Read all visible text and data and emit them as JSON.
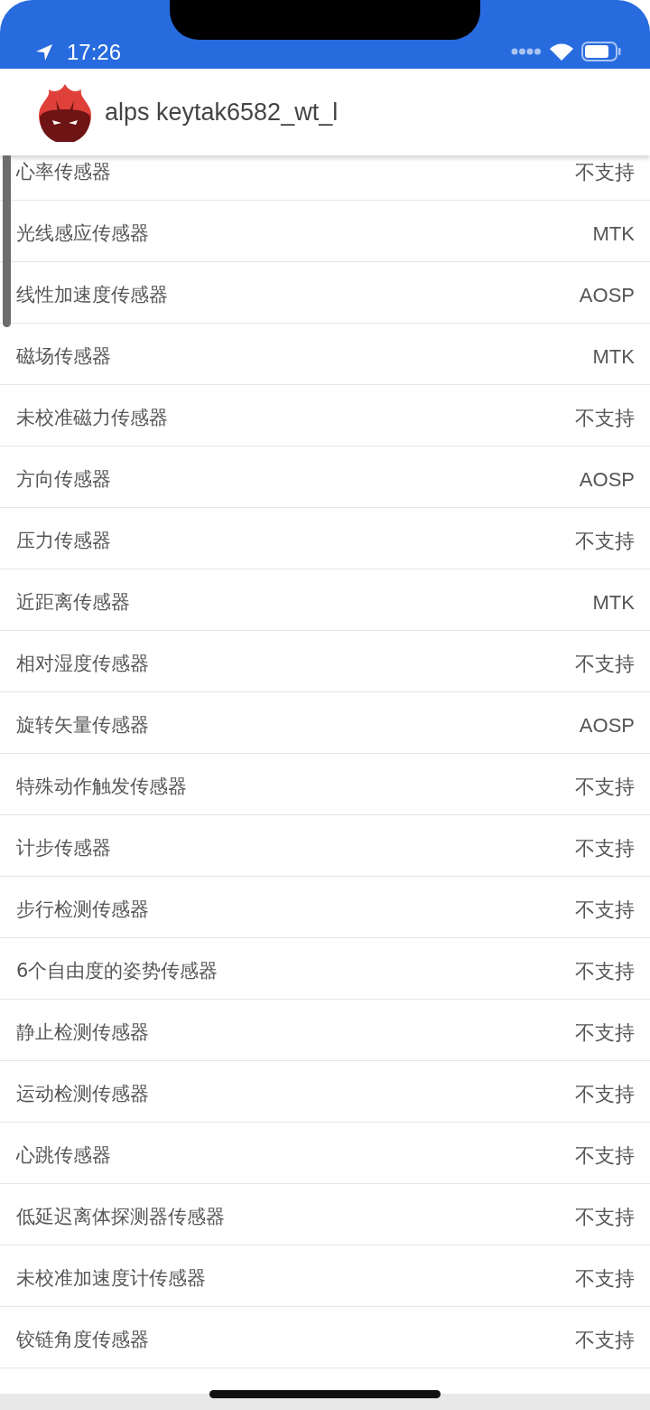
{
  "status_bar": {
    "time": "17:26"
  },
  "header": {
    "title": "alps keytak6582_wt_l"
  },
  "sensors": [
    {
      "name": "心率传感器",
      "value": "不支持"
    },
    {
      "name": "光线感应传感器",
      "value": "MTK"
    },
    {
      "name": "线性加速度传感器",
      "value": "AOSP"
    },
    {
      "name": "磁场传感器",
      "value": "MTK"
    },
    {
      "name": "未校准磁力传感器",
      "value": "不支持"
    },
    {
      "name": "方向传感器",
      "value": "AOSP"
    },
    {
      "name": "压力传感器",
      "value": "不支持"
    },
    {
      "name": "近距离传感器",
      "value": "MTK"
    },
    {
      "name": "相对湿度传感器",
      "value": "不支持"
    },
    {
      "name": "旋转矢量传感器",
      "value": "AOSP"
    },
    {
      "name": "特殊动作触发传感器",
      "value": "不支持"
    },
    {
      "name": "计步传感器",
      "value": "不支持"
    },
    {
      "name": "步行检测传感器",
      "value": "不支持"
    },
    {
      "name": "6个自由度的姿势传感器",
      "value": "不支持"
    },
    {
      "name": "静止检测传感器",
      "value": "不支持"
    },
    {
      "name": "运动检测传感器",
      "value": "不支持"
    },
    {
      "name": "心跳传感器",
      "value": "不支持"
    },
    {
      "name": "低延迟离体探测器传感器",
      "value": "不支持"
    },
    {
      "name": "未校准加速度计传感器",
      "value": "不支持"
    },
    {
      "name": "铰链角度传感器",
      "value": "不支持"
    }
  ]
}
